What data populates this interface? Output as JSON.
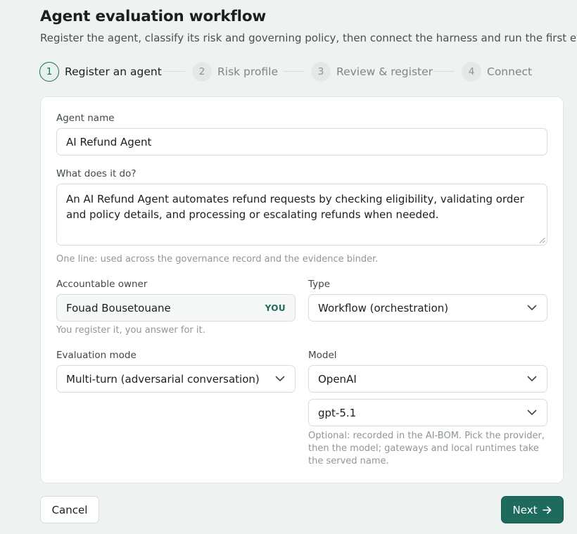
{
  "header": {
    "title": "Agent evaluation workflow",
    "subtitle": "Register the agent, classify its risk and governing policy, then connect the harness and run the first evalua"
  },
  "stepper": {
    "steps": [
      {
        "number": "1",
        "label": "Register an agent",
        "state": "active"
      },
      {
        "number": "2",
        "label": "Risk profile",
        "state": "upcoming"
      },
      {
        "number": "3",
        "label": "Review & register",
        "state": "upcoming"
      },
      {
        "number": "4",
        "label": "Connect",
        "state": "upcoming"
      }
    ]
  },
  "form": {
    "agent_name": {
      "label": "Agent name",
      "value": "AI Refund Agent"
    },
    "description": {
      "label": "What does it do?",
      "value": "An AI Refund Agent automates refund requests by checking eligibility, validating order and policy details, and processing or escalating refunds when needed.",
      "hint": "One line: used across the governance record and the evidence binder."
    },
    "owner": {
      "label": "Accountable owner",
      "value": "Fouad Bousetouane",
      "badge": "YOU",
      "hint": "You register it, you answer for it."
    },
    "type": {
      "label": "Type",
      "value": "Workflow (orchestration)"
    },
    "evaluation_mode": {
      "label": "Evaluation mode",
      "value": "Multi-turn (adversarial conversation)"
    },
    "model": {
      "label": "Model",
      "provider": "OpenAI",
      "model_name": "gpt-5.1",
      "hint": "Optional: recorded in the AI-BOM. Pick the provider, then the model; gateways and local runtimes take the served name."
    }
  },
  "actions": {
    "cancel_label": "Cancel",
    "next_label": "Next"
  },
  "icons": {
    "select": "chevron-down-icon",
    "next": "arrow-right-icon",
    "resize": "resize-handle-icon"
  },
  "colors": {
    "accent": "#1e6b5d",
    "background": "#eef2f0",
    "card": "#ffffff"
  }
}
